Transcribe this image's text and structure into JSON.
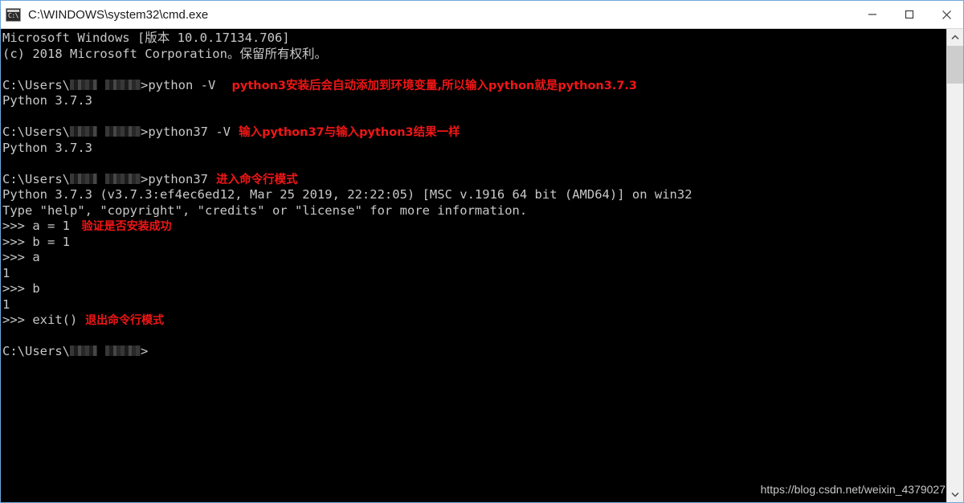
{
  "window": {
    "title": "C:\\WINDOWS\\system32\\cmd.exe",
    "icon": "cmd-console-icon",
    "icon_glyph": "C:\\",
    "controls": {
      "minimize": "minimize-button",
      "maximize": "maximize-button",
      "close": "close-button"
    },
    "colors": {
      "titlebar_bg": "#ffffff",
      "console_bg": "#000000",
      "console_fg": "#c8c8c8",
      "annotation_red": "#f01616",
      "border": "#6fa8dc",
      "scrollbar_track": "#f0f0f0",
      "scrollbar_thumb": "#cdcdcd"
    }
  },
  "console": {
    "lines": [
      {
        "text": "Microsoft Windows [版本 10.0.17134.706]"
      },
      {
        "text": "(c) 2018 Microsoft Corporation。保留所有权利。"
      },
      {
        "text": ""
      },
      {
        "prompt_prefix": "C:\\Users\\",
        "masked": true,
        "command": ">python -V",
        "annotation": "python3安装后会自动添加到环境变量,所以输入python就是python3.7.3"
      },
      {
        "text": "Python 3.7.3"
      },
      {
        "text": ""
      },
      {
        "prompt_prefix": "C:\\Users\\",
        "masked": true,
        "command": ">python37 -V",
        "annotation": "输入python37与输入python3结果一样"
      },
      {
        "text": "Python 3.7.3"
      },
      {
        "text": ""
      },
      {
        "prompt_prefix": "C:\\Users\\",
        "masked": true,
        "command": ">python37",
        "annotation": "进入命令行模式"
      },
      {
        "text": "Python 3.7.3 (v3.7.3:ef4ec6ed12, Mar 25 2019, 22:22:05) [MSC v.1916 64 bit (AMD64)] on win32"
      },
      {
        "text": "Type \"help\", \"copyright\", \"credits\" or \"license\" for more information."
      },
      {
        "text": ">>> a = 1",
        "annotation": "验证是否安装成功"
      },
      {
        "text": ">>> b = 1"
      },
      {
        "text": ">>> a"
      },
      {
        "text": "1"
      },
      {
        "text": ">>> b"
      },
      {
        "text": "1"
      },
      {
        "text": ">>> exit()",
        "annotation": "退出命令行模式"
      },
      {
        "text": ""
      },
      {
        "prompt_prefix": "C:\\Users\\",
        "masked": true,
        "command": ">"
      }
    ]
  },
  "watermark": {
    "text": "https://blog.csdn.net/weixin_4379027"
  }
}
